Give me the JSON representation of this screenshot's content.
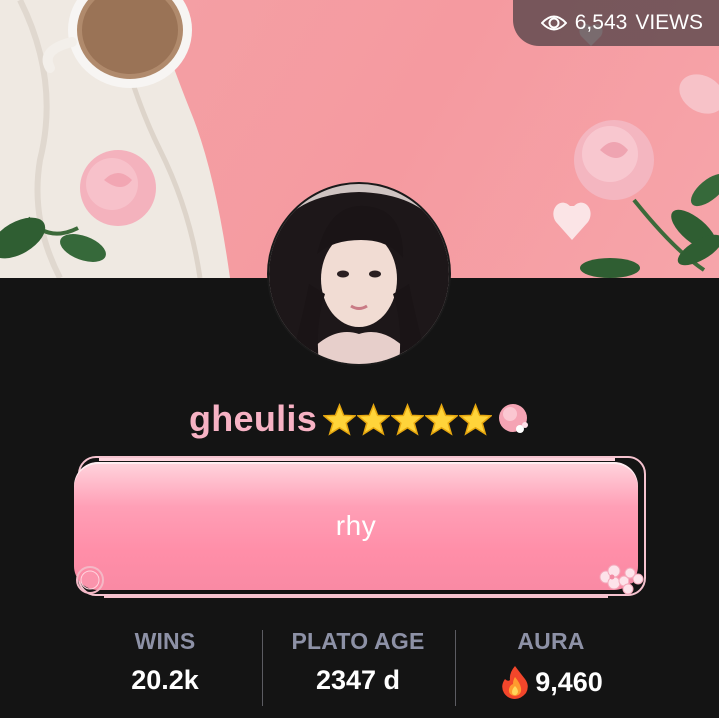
{
  "views": {
    "count": "6,543",
    "label": "VIEWS",
    "icon": "eye-icon"
  },
  "profile": {
    "username": "gheulis",
    "badges": [
      "star-icon",
      "star-icon",
      "star-icon",
      "star-icon",
      "star-icon",
      "peach-blossom-icon"
    ],
    "bio": "rhy"
  },
  "stats": {
    "wins": {
      "label": "WINS",
      "value": "20.2k"
    },
    "plato_age": {
      "label": "PLATO AGE",
      "value": "2347 d"
    },
    "aura": {
      "label": "AURA",
      "value": "9,460",
      "icon": "fire-icon"
    }
  },
  "colors": {
    "page_background": "#141414",
    "banner_pink": "#f59aa0",
    "username_pink": "#f7b2c4",
    "bio_card_pink": "#ff8ea8",
    "stat_label": "#8d91a6",
    "stat_value": "#ffffff",
    "star_gold": "#ffd43a"
  }
}
